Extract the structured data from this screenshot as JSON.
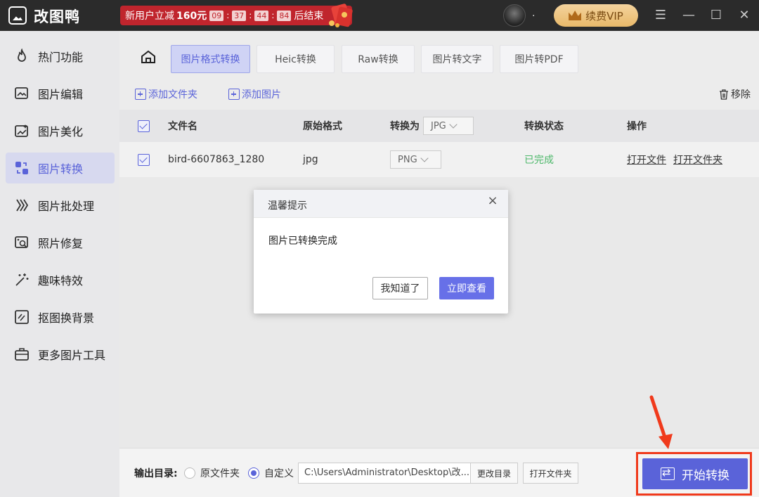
{
  "app": {
    "title": "改图鸭"
  },
  "promo": {
    "text": "新用户立减",
    "amount": "160元",
    "countdown": [
      "09",
      "37",
      "44",
      "84"
    ],
    "suffix": "后结束"
  },
  "user": {
    "name": "."
  },
  "vip": {
    "label": "续费VIP"
  },
  "sidebar": {
    "items": [
      {
        "label": "热门功能",
        "icon": "fire-icon"
      },
      {
        "label": "图片编辑",
        "icon": "image-edit-icon"
      },
      {
        "label": "图片美化",
        "icon": "image-beautify-icon"
      },
      {
        "label": "图片转换",
        "icon": "image-convert-icon",
        "active": true
      },
      {
        "label": "图片批处理",
        "icon": "batch-icon"
      },
      {
        "label": "照片修复",
        "icon": "photo-repair-icon"
      },
      {
        "label": "趣味特效",
        "icon": "magic-icon"
      },
      {
        "label": "抠图换背景",
        "icon": "cutout-icon"
      },
      {
        "label": "更多图片工具",
        "icon": "toolbox-icon"
      }
    ]
  },
  "tabs": [
    {
      "label": "图片格式转换",
      "active": true
    },
    {
      "label": "Heic转换"
    },
    {
      "label": "Raw转换"
    },
    {
      "label": "图片转文字"
    },
    {
      "label": "图片转PDF"
    }
  ],
  "toolbar": {
    "add_folder": "添加文件夹",
    "add_image": "添加图片",
    "remove": "移除"
  },
  "table": {
    "headers": {
      "filename": "文件名",
      "original_format": "原始格式",
      "convert_to": "转换为",
      "convert_to_value": "JPG",
      "status": "转换状态",
      "actions": "操作"
    },
    "rows": [
      {
        "filename": "bird-6607863_1280",
        "original_format": "jpg",
        "target": "PNG",
        "status": "已完成",
        "open_file": "打开文件",
        "open_folder": "打开文件夹"
      }
    ]
  },
  "bottom": {
    "output_label": "输出目录:",
    "option_original": "原文件夹",
    "option_custom": "自定义",
    "path": "C:\\Users\\Administrator\\Desktop\\改...",
    "change_dir": "更改目录",
    "open_folder": "打开文件夹",
    "start": "开始转换"
  },
  "dialog": {
    "title": "温馨提示",
    "message": "图片已转换完成",
    "ok": "我知道了",
    "view": "立即查看"
  },
  "colors": {
    "accent": "#5a63d9",
    "highlight": "#f03a1c",
    "success": "#4db86a",
    "promo": "#c0252d"
  }
}
